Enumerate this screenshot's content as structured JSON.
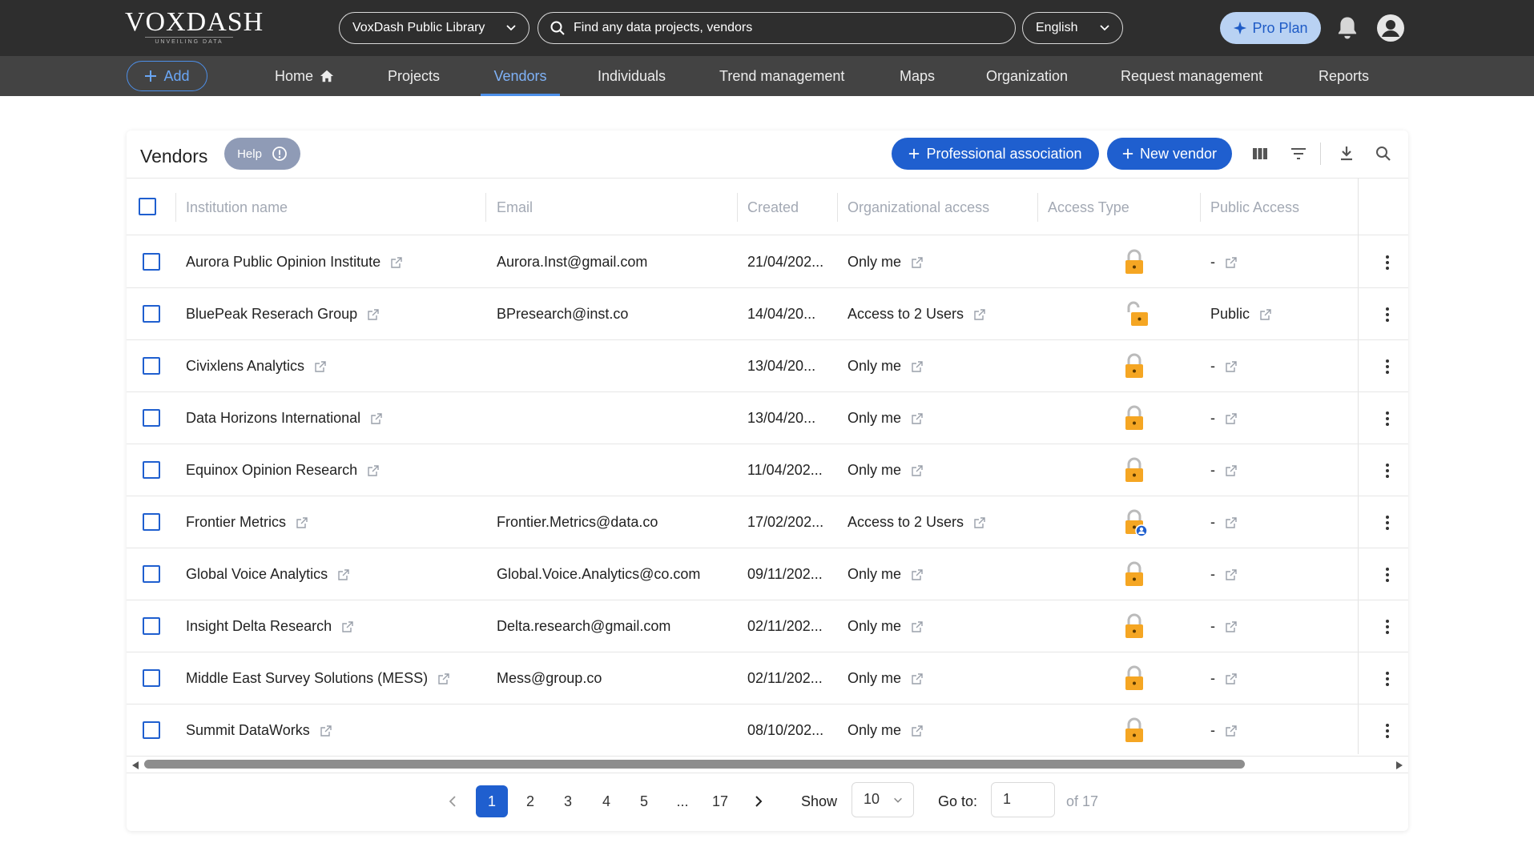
{
  "header": {
    "brand": "VOXDASH",
    "tagline": "UNVEILING DATA",
    "library_select": "VoxDash Public Library",
    "search_placeholder": "Find any data projects, vendors",
    "language": "English",
    "pro_plan": "Pro Plan"
  },
  "nav": {
    "add_label": "Add",
    "items": [
      "Home",
      "Projects",
      "Vendors",
      "Individuals",
      "Trend management",
      "Maps",
      "Organization",
      "Request management",
      "Reports"
    ],
    "active": "Vendors"
  },
  "card": {
    "title": "Vendors",
    "help_label": "Help",
    "professional_association": "Professional association",
    "new_vendor": "New vendor"
  },
  "table": {
    "columns": [
      "Institution name",
      "Email",
      "Created",
      "Organizational access",
      "Access Type",
      "Public Access"
    ],
    "rows": [
      {
        "name": "Aurora Public Opinion Institute",
        "email": "Aurora.Inst@gmail.com",
        "created": "21/04/202...",
        "org_access": "Only me",
        "access_type": "locked",
        "public_access": "-"
      },
      {
        "name": "BluePeak Reserach Group",
        "email": "BPresearch@inst.co",
        "created": "14/04/20...",
        "org_access": "Access to 2 Users",
        "access_type": "unlocked",
        "public_access": "Public"
      },
      {
        "name": "Civixlens Analytics",
        "email": "",
        "created": "13/04/20...",
        "org_access": "Only me",
        "access_type": "locked",
        "public_access": "-"
      },
      {
        "name": "Data Horizons International",
        "email": "",
        "created": "13/04/20...",
        "org_access": "Only me",
        "access_type": "locked",
        "public_access": "-"
      },
      {
        "name": "Equinox Opinion Research",
        "email": "",
        "created": "11/04/202...",
        "org_access": "Only me",
        "access_type": "locked",
        "public_access": "-"
      },
      {
        "name": "Frontier Metrics",
        "email": "Frontier.Metrics@data.co",
        "created": "17/02/202...",
        "org_access": "Access to 2 Users",
        "access_type": "shared",
        "public_access": "-"
      },
      {
        "name": "Global Voice Analytics",
        "email": "Global.Voice.Analytics@co.com",
        "created": "09/11/202...",
        "org_access": "Only me",
        "access_type": "locked",
        "public_access": "-"
      },
      {
        "name": "Insight Delta Research",
        "email": "Delta.research@gmail.com",
        "created": "02/11/202...",
        "org_access": "Only me",
        "access_type": "locked",
        "public_access": "-"
      },
      {
        "name": "Middle East Survey Solutions (MESS)",
        "email": "Mess@group.co",
        "created": "02/11/202...",
        "org_access": "Only me",
        "access_type": "locked",
        "public_access": "-"
      },
      {
        "name": "Summit DataWorks",
        "email": "",
        "created": "08/10/202...",
        "org_access": "Only me",
        "access_type": "locked",
        "public_access": "-"
      }
    ]
  },
  "pagination": {
    "pages": [
      "1",
      "2",
      "3",
      "4",
      "5",
      "...",
      "17"
    ],
    "current": "1",
    "show_label": "Show",
    "page_size": "10",
    "goto_label": "Go to:",
    "goto_value": "1",
    "of_label": "of 17"
  },
  "colors": {
    "primary": "#1f5fcf",
    "topbar": "#2e2e2e",
    "navbar": "#434343",
    "lock": "#f5a623"
  }
}
